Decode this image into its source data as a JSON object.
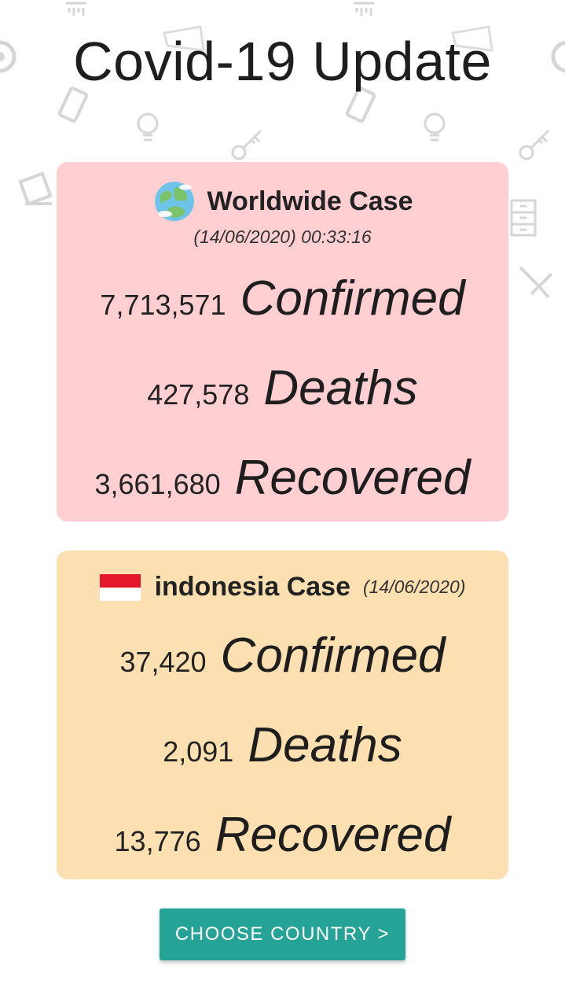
{
  "app": {
    "title": "Covid-19 Update"
  },
  "worldwide": {
    "title": "Worldwide Case",
    "timestamp": "(14/06/2020) 00:33:16",
    "icon": "globe-icon",
    "color": "#ffcfd2",
    "stats": [
      {
        "value": "7,713,571",
        "label": "Confirmed"
      },
      {
        "value": "427,578",
        "label": "Deaths"
      },
      {
        "value": "3,661,680",
        "label": "Recovered"
      }
    ]
  },
  "country": {
    "title": "indonesia Case",
    "date": "(14/06/2020)",
    "icon": "indonesia-flag-icon",
    "color": "#fde0b1",
    "stats": [
      {
        "value": "37,420",
        "label": "Confirmed"
      },
      {
        "value": "2,091",
        "label": "Deaths"
      },
      {
        "value": "13,776",
        "label": "Recovered"
      }
    ]
  },
  "actions": {
    "choose_country_label": "CHOOSE COUNTRY >"
  },
  "colors": {
    "accent": "#24a396"
  }
}
